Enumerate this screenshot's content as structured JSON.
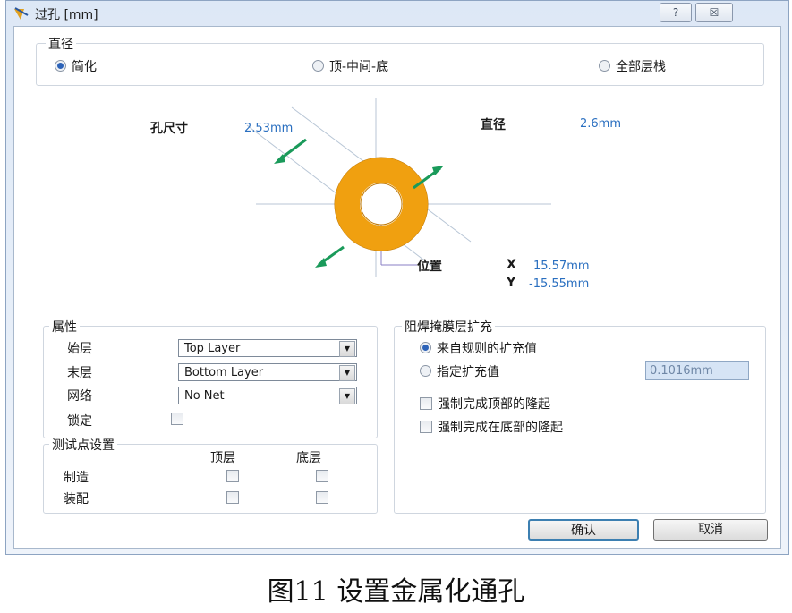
{
  "window": {
    "title": "过孔 [mm]",
    "help_button": "?",
    "close_button": "☒"
  },
  "diameter_group": {
    "title": "直径",
    "options": [
      {
        "label": "简化",
        "selected": true
      },
      {
        "label": "顶-中间-底",
        "selected": false
      },
      {
        "label": "全部层栈",
        "selected": false
      }
    ]
  },
  "preview": {
    "hole_size_label": "孔尺寸",
    "hole_size_value": "2.53mm",
    "diameter_label": "直径",
    "diameter_value": "2.6mm",
    "location_label": "位置",
    "x_label": "X",
    "x_value": "15.57mm",
    "y_label": "Y",
    "y_value": "-15.55mm",
    "ring_color": "#f0a010",
    "arrow_color": "#1a9a5a"
  },
  "properties": {
    "title": "属性",
    "start_layer_label": "始层",
    "start_layer_value": "Top Layer",
    "end_layer_label": "末层",
    "end_layer_value": "Bottom Layer",
    "net_label": "网络",
    "net_value": "No Net",
    "lock_label": "锁定",
    "lock_checked": false
  },
  "testpoint": {
    "title": "测试点设置",
    "col_top": "顶层",
    "col_bottom": "底层",
    "row_fab": "制造",
    "row_assy": "装配"
  },
  "solder_mask": {
    "title": "阻焊掩膜层扩充",
    "rule_label": "来自规则的扩充值",
    "specified_label": "指定扩充值",
    "specified_value": "0.1016mm",
    "force_top_label": "强制完成顶部的隆起",
    "force_bottom_label": "强制完成在底部的隆起"
  },
  "buttons": {
    "ok": "确认",
    "cancel": "取消"
  },
  "caption": "图11   设置金属化通孔"
}
